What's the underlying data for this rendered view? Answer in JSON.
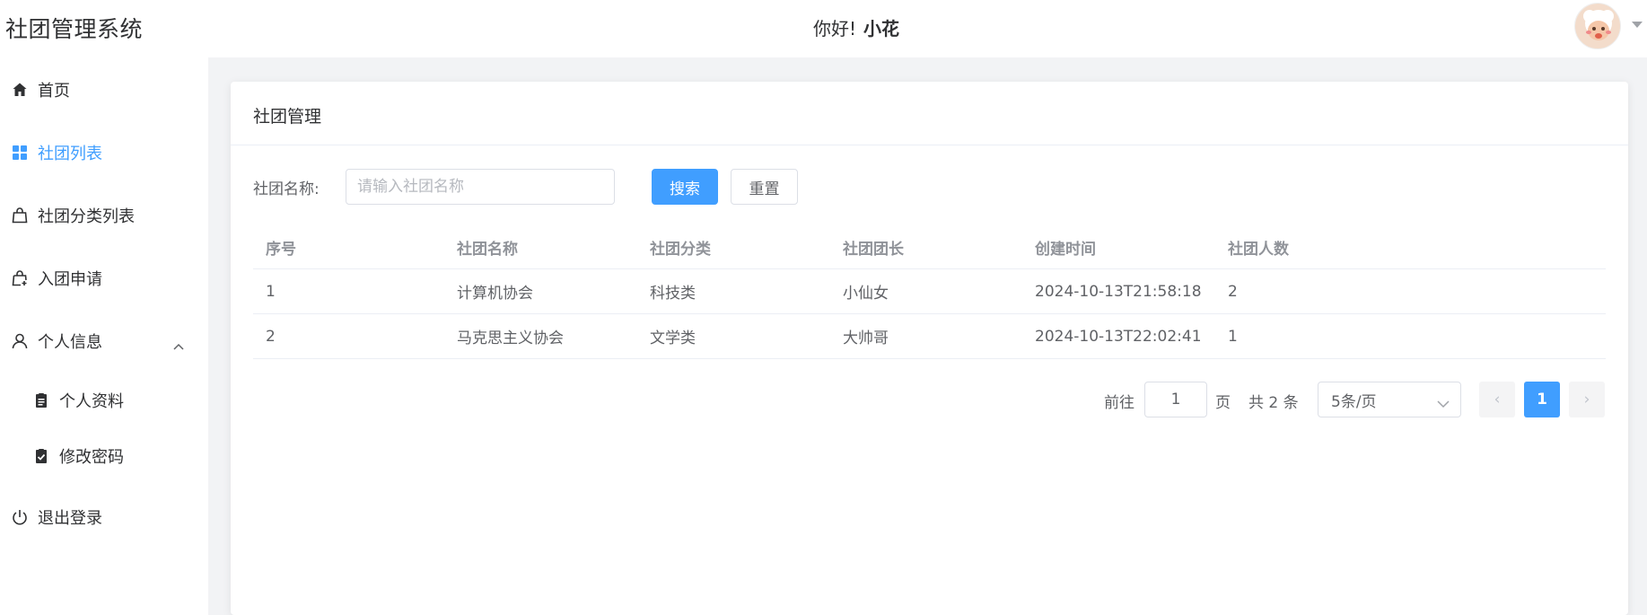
{
  "header": {
    "app_title": "社团管理系统",
    "greeting_prefix": "你好!",
    "username": "小花"
  },
  "sidebar": {
    "items": [
      {
        "label": "首页",
        "icon": "home-icon"
      },
      {
        "label": "社团列表",
        "icon": "grid-icon",
        "active": true
      },
      {
        "label": "社团分类列表",
        "icon": "bag-icon"
      },
      {
        "label": "入团申请",
        "icon": "bag-plus-icon"
      },
      {
        "label": "个人信息",
        "icon": "user-icon",
        "expanded": true,
        "children": [
          {
            "label": "个人资料",
            "icon": "document-icon"
          },
          {
            "label": "修改密码",
            "icon": "clipboard-check-icon"
          }
        ]
      },
      {
        "label": "退出登录",
        "icon": "power-icon"
      }
    ]
  },
  "card": {
    "title": "社团管理"
  },
  "search": {
    "label": "社团名称:",
    "placeholder": "请输入社团名称",
    "value": "",
    "search_button": "搜索",
    "reset_button": "重置"
  },
  "table": {
    "columns": [
      "序号",
      "社团名称",
      "社团分类",
      "社团团长",
      "创建时间",
      "社团人数"
    ],
    "rows": [
      [
        "1",
        "计算机协会",
        "科技类",
        "小仙女",
        "2024-10-13T21:58:18",
        "2"
      ],
      [
        "2",
        "马克思主义协会",
        "文学类",
        "大帅哥",
        "2024-10-13T22:02:41",
        "1"
      ]
    ]
  },
  "pagination": {
    "goto_prefix": "前往",
    "goto_value": "1",
    "goto_suffix": "页",
    "total_text": "共 2 条",
    "page_size": "5条/页",
    "prev_symbol": "‹",
    "next_symbol": "›",
    "current_page": "1"
  },
  "colors": {
    "accent": "#409eff",
    "background": "#f2f3f5",
    "text": "#303133",
    "muted": "#909399"
  }
}
